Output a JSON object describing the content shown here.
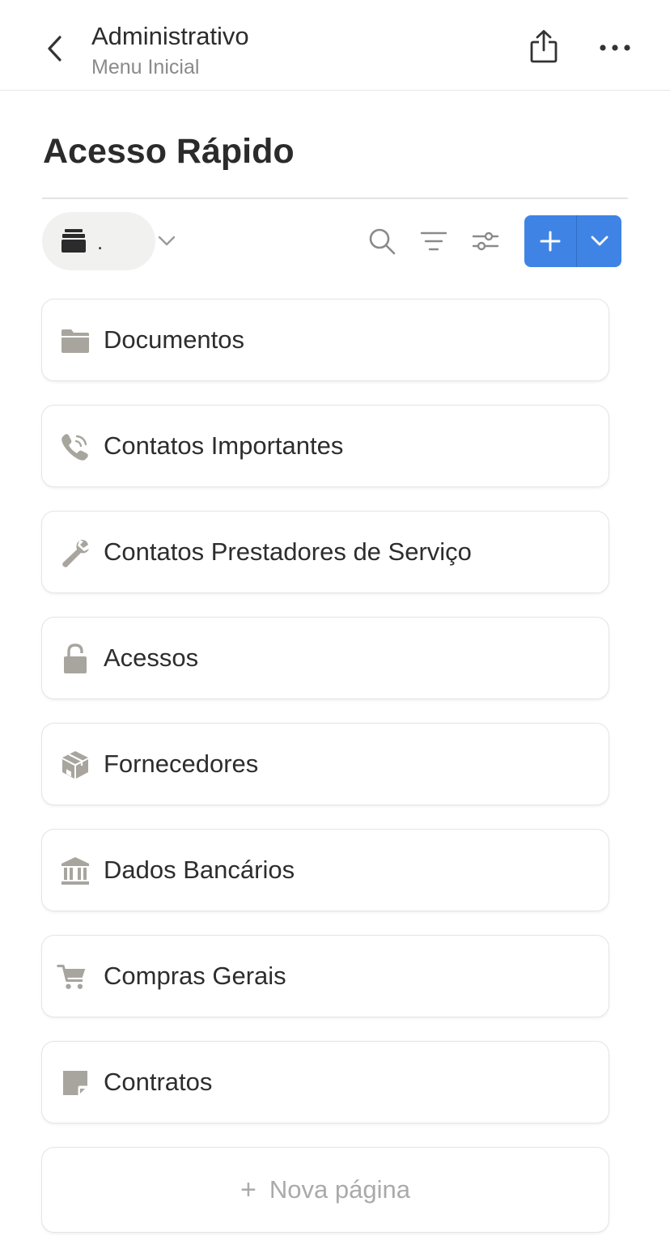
{
  "header": {
    "title": "Administrativo",
    "subtitle": "Menu Inicial"
  },
  "page": {
    "title": "Acesso Rápido"
  },
  "toolbar": {
    "view_label": ".",
    "accent_color": "#3f84e5"
  },
  "items": [
    {
      "label": "Documentos",
      "icon": "folder-icon"
    },
    {
      "label": "Contatos Importantes",
      "icon": "phone-icon"
    },
    {
      "label": "Contatos Prestadores de Serviço",
      "icon": "wrench-icon"
    },
    {
      "label": "Acessos",
      "icon": "lock-icon"
    },
    {
      "label": "Fornecedores",
      "icon": "box-icon"
    },
    {
      "label": "Dados Bancários",
      "icon": "bank-icon"
    },
    {
      "label": "Compras Gerais",
      "icon": "cart-icon"
    },
    {
      "label": "Contratos",
      "icon": "note-icon"
    }
  ],
  "new_page": {
    "label": "Nova página"
  }
}
